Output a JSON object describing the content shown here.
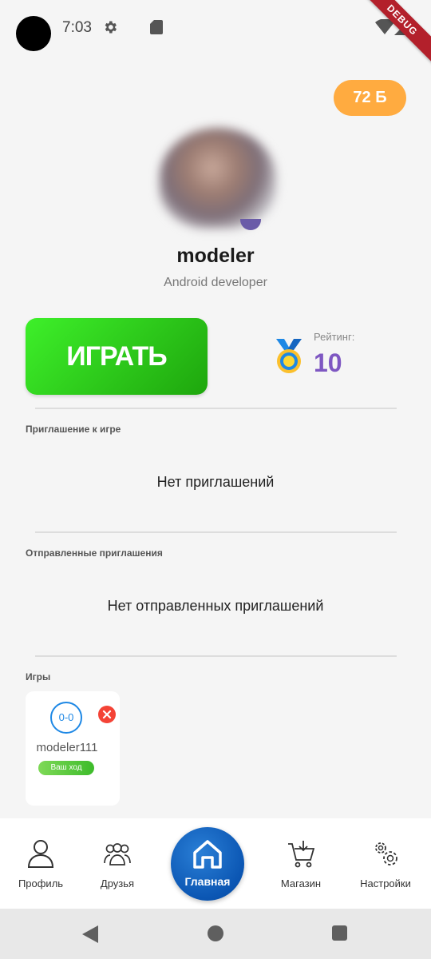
{
  "status_bar": {
    "time": "7:03",
    "icons": [
      "gear-icon",
      "sd-card-icon",
      "wifi-icon",
      "signal-icon"
    ],
    "debug_label": "DEBUG"
  },
  "balance": {
    "label": "72 Б"
  },
  "profile": {
    "username": "modeler",
    "role": "Android developer"
  },
  "play_button": {
    "label": "ИГРАТЬ"
  },
  "rating": {
    "label": "Рейтинг:",
    "value": "10"
  },
  "invitations": {
    "title": "Приглашение к игре",
    "empty_text": "Нет приглашений"
  },
  "sent_invitations": {
    "title": "Отправленные приглашения",
    "empty_text": "Нет отправленных приглашений"
  },
  "games": {
    "title": "Игры",
    "items": [
      {
        "score": "0-0",
        "opponent": "modeler111",
        "status": "Ваш ход"
      }
    ]
  },
  "bottom_nav": {
    "items": [
      {
        "label": "Профиль",
        "icon": "person-icon"
      },
      {
        "label": "Друзья",
        "icon": "friends-icon"
      },
      {
        "label": "Главная",
        "icon": "home-icon"
      },
      {
        "label": "Магазин",
        "icon": "cart-icon"
      },
      {
        "label": "Настройки",
        "icon": "settings-icon"
      }
    ]
  },
  "colors": {
    "accent_orange": "#ffab40",
    "play_green": "#2ed41c",
    "rating_purple": "#7e57c2",
    "home_blue": "#0b56b3",
    "delete_red": "#f44336"
  }
}
